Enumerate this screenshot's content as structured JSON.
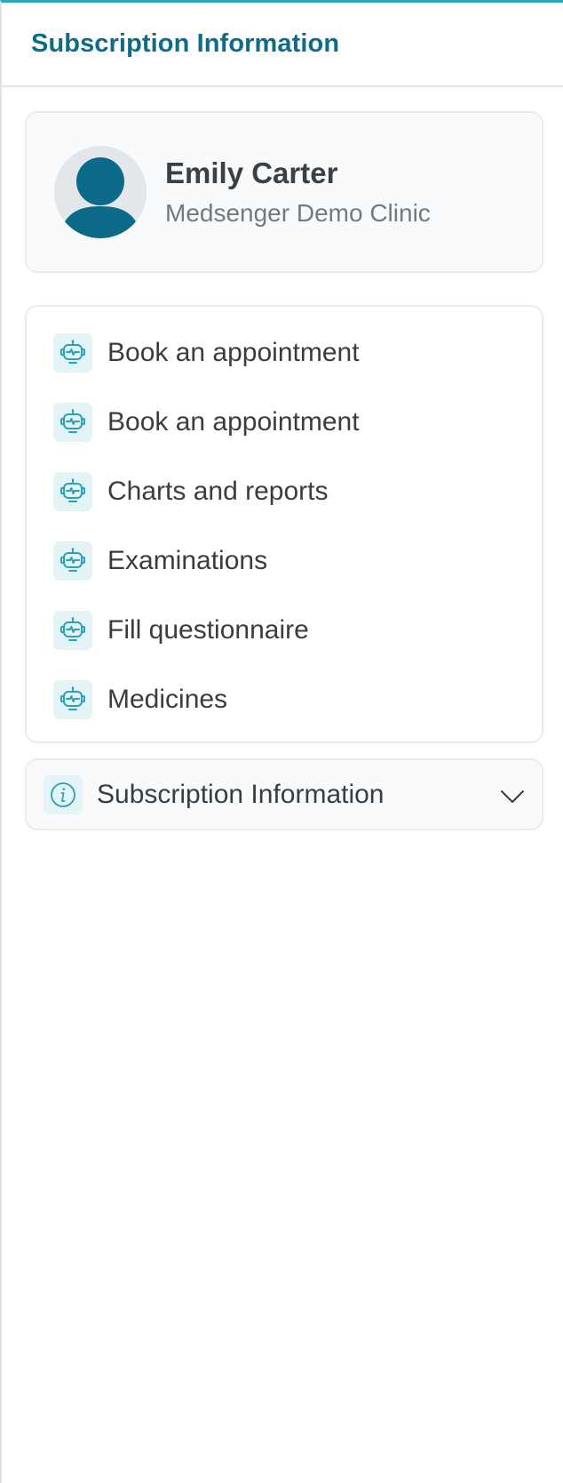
{
  "header": {
    "title": "Subscription Information"
  },
  "profile": {
    "name": "Emily Carter",
    "clinic": "Medsenger Demo Clinic",
    "avatar_icon": "user-avatar-icon"
  },
  "menu": {
    "items": [
      {
        "label": "Book an appointment",
        "icon": "robot-icon"
      },
      {
        "label": "Book an appointment",
        "icon": "robot-icon"
      },
      {
        "label": "Charts and reports",
        "icon": "robot-icon"
      },
      {
        "label": "Examinations",
        "icon": "robot-icon"
      },
      {
        "label": "Fill questionnaire",
        "icon": "robot-icon"
      },
      {
        "label": "Medicines",
        "icon": "robot-icon"
      }
    ]
  },
  "accordion": {
    "label": "Subscription Information",
    "icon": "info-icon",
    "toggle_icon": "chevron-down-icon",
    "expanded": false
  },
  "colors": {
    "accent": "#0e6c86",
    "top_border": "#2aa9b8",
    "icon_bg": "#e4f3f5",
    "icon_stroke": "#2aa3b3",
    "avatar_bg": "#e3e6ea",
    "avatar_fg": "#0b6a88"
  }
}
